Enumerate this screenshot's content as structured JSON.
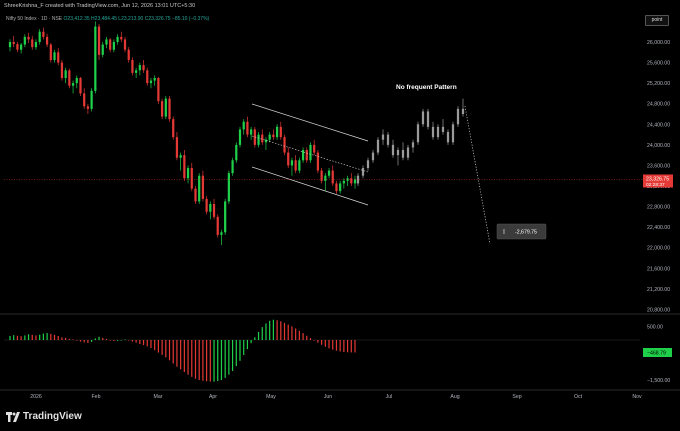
{
  "header": {
    "attribution": "ShreeKrishna_F created with TradingView.com, Jun 12, 2026 13:01 UTC+5:30",
    "symbol": "Nifty 50 Index · 1D · NSE",
    "ohlc": "O23,412.35 H23,484.45 L23,213.90 C23,326.75 −85.10 (−0.37%)"
  },
  "controls": {
    "point_label": "point"
  },
  "brand": {
    "name": "TradingView"
  },
  "chart_data": {
    "type": "candlestick",
    "symbol": "Nifty 50 Index",
    "interval": "1D",
    "exchange": "NSE",
    "ohlc_last": {
      "open": 23412.35,
      "high": 23484.45,
      "low": 23213.9,
      "close": 23326.75,
      "change": -85.1,
      "change_pct": -0.37
    },
    "price_axis": {
      "ticks": [
        26000,
        25600,
        25200,
        24800,
        24400,
        24000,
        23600,
        23200,
        22800,
        22400,
        22000,
        21600,
        21200,
        20800
      ],
      "tick_labels": [
        "26,000.00",
        "25,600.00",
        "25,200.00",
        "24,800.00",
        "24,400.00",
        "24,000.00",
        "23,600.00",
        "23,200.00",
        "22,800.00",
        "22,400.00",
        "22,000.00",
        "21,600.00",
        "21,200.00",
        "20,800.00"
      ],
      "range": [
        20750,
        26350
      ]
    },
    "last_price_label": "23,326.75",
    "countdown_label": "02:28:37",
    "time_axis": {
      "labels": [
        "2026",
        "Feb",
        "Mar",
        "Apr",
        "May",
        "Jun",
        "Jul",
        "Aug",
        "Sep",
        "Oct",
        "Nov"
      ]
    },
    "annotation": "No frequent Pattern",
    "projection_label": "-2,679.75",
    "candles": [
      [
        25900,
        26050,
        25820,
        26000
      ],
      [
        26000,
        26120,
        25900,
        25960
      ],
      [
        25960,
        26000,
        25800,
        25850
      ],
      [
        25850,
        25980,
        25780,
        25950
      ],
      [
        25950,
        26150,
        25900,
        26100
      ],
      [
        26100,
        26180,
        25980,
        26050
      ],
      [
        26050,
        26120,
        25850,
        25900
      ],
      [
        25900,
        26050,
        25850,
        26000
      ],
      [
        26000,
        26250,
        25950,
        26200
      ],
      [
        26200,
        26280,
        26050,
        26100
      ],
      [
        26100,
        26160,
        25900,
        25950
      ],
      [
        25950,
        25980,
        25600,
        25650
      ],
      [
        25650,
        25850,
        25600,
        25800
      ],
      [
        25800,
        25880,
        25550,
        25600
      ],
      [
        25600,
        25650,
        25250,
        25300
      ],
      [
        25300,
        25500,
        25200,
        25450
      ],
      [
        25450,
        25480,
        25100,
        25150
      ],
      [
        25150,
        25250,
        25000,
        25200
      ],
      [
        25200,
        25350,
        25100,
        25300
      ],
      [
        25300,
        25320,
        24950,
        25000
      ],
      [
        25000,
        25100,
        24700,
        24750
      ],
      [
        24750,
        24800,
        24600,
        24700
      ],
      [
        24700,
        25100,
        24650,
        25050
      ],
      [
        25050,
        26400,
        25000,
        26300
      ],
      [
        26300,
        26350,
        25650,
        25750
      ],
      [
        25750,
        26000,
        25700,
        25950
      ],
      [
        25950,
        26100,
        25880,
        26050
      ],
      [
        26050,
        26080,
        25800,
        25850
      ],
      [
        25850,
        26050,
        25800,
        26000
      ],
      [
        26000,
        26150,
        25950,
        26100
      ],
      [
        26100,
        26200,
        26000,
        26050
      ],
      [
        26050,
        26100,
        25800,
        25850
      ],
      [
        25850,
        25900,
        25600,
        25650
      ],
      [
        25650,
        25700,
        25350,
        25400
      ],
      [
        25400,
        25500,
        25300,
        25450
      ],
      [
        25450,
        25600,
        25350,
        25550
      ],
      [
        25550,
        25650,
        25400,
        25450
      ],
      [
        25450,
        25500,
        25150,
        25200
      ],
      [
        25200,
        25300,
        25100,
        25250
      ],
      [
        25250,
        25350,
        25150,
        25300
      ],
      [
        25300,
        25320,
        24800,
        24850
      ],
      [
        24850,
        24900,
        24500,
        24550
      ],
      [
        24550,
        24950,
        24500,
        24900
      ],
      [
        24900,
        24950,
        24450,
        24500
      ],
      [
        24500,
        24550,
        24100,
        24150
      ],
      [
        24150,
        24250,
        23700,
        23750
      ],
      [
        23750,
        23850,
        23500,
        23800
      ],
      [
        23800,
        23900,
        23300,
        23350
      ],
      [
        23350,
        23600,
        23250,
        23550
      ],
      [
        23550,
        23650,
        23100,
        23150
      ],
      [
        23150,
        23200,
        22850,
        22900
      ],
      [
        22900,
        23450,
        22850,
        23400
      ],
      [
        23400,
        23500,
        22900,
        22950
      ],
      [
        22950,
        23000,
        22650,
        22700
      ],
      [
        22700,
        22900,
        22550,
        22850
      ],
      [
        22850,
        22950,
        22550,
        22600
      ],
      [
        22600,
        22650,
        22200,
        22250
      ],
      [
        22250,
        22350,
        22050,
        22300
      ],
      [
        22300,
        22950,
        22250,
        22900
      ],
      [
        22900,
        23500,
        22850,
        23450
      ],
      [
        23450,
        23750,
        23400,
        23700
      ],
      [
        23700,
        24050,
        23650,
        24000
      ],
      [
        24000,
        24350,
        23950,
        24300
      ],
      [
        24300,
        24500,
        24200,
        24450
      ],
      [
        24450,
        24550,
        24150,
        24200
      ],
      [
        24200,
        24350,
        24100,
        24300
      ],
      [
        24300,
        24350,
        23950,
        24000
      ],
      [
        24000,
        24250,
        23950,
        24200
      ],
      [
        24200,
        24300,
        24000,
        24050
      ],
      [
        24050,
        24150,
        23900,
        24100
      ],
      [
        24100,
        24250,
        24050,
        24200
      ],
      [
        24200,
        24300,
        24100,
        24150
      ],
      [
        24150,
        24400,
        24100,
        24350
      ],
      [
        24350,
        24450,
        24100,
        24150
      ],
      [
        24150,
        24200,
        23800,
        23850
      ],
      [
        23850,
        23950,
        23550,
        23600
      ],
      [
        23600,
        23750,
        23400,
        23700
      ],
      [
        23700,
        23800,
        23450,
        23500
      ],
      [
        23500,
        23750,
        23450,
        23700
      ],
      [
        23700,
        23950,
        23650,
        23900
      ],
      [
        23900,
        23950,
        23650,
        23700
      ],
      [
        23700,
        24050,
        23650,
        24000
      ],
      [
        24000,
        24100,
        23800,
        23850
      ],
      [
        23850,
        23900,
        23450,
        23500
      ],
      [
        23500,
        23550,
        23250,
        23300
      ],
      [
        23300,
        23450,
        23100,
        23400
      ],
      [
        23400,
        23550,
        23350,
        23500
      ],
      [
        23500,
        23600,
        23200,
        23250
      ],
      [
        23250,
        23300,
        23050,
        23100
      ],
      [
        23100,
        23300,
        23050,
        23250
      ],
      [
        23250,
        23350,
        23150,
        23300
      ],
      [
        23300,
        23400,
        23200,
        23350
      ],
      [
        23350,
        23450,
        23200,
        23250
      ],
      [
        23250,
        23400,
        23150,
        23327
      ]
    ],
    "projected_candles": [
      [
        23250,
        23450,
        23200,
        23400
      ],
      [
        23400,
        23600,
        23350,
        23550
      ],
      [
        23550,
        23750,
        23500,
        23700
      ],
      [
        23700,
        23900,
        23650,
        23850
      ],
      [
        23850,
        24150,
        23800,
        24100
      ],
      [
        24100,
        24300,
        24000,
        24200
      ],
      [
        24200,
        24250,
        23950,
        24000
      ],
      [
        24000,
        24100,
        23750,
        23800
      ],
      [
        23800,
        23950,
        23600,
        23900
      ],
      [
        23900,
        24050,
        23700,
        23750
      ],
      [
        23750,
        24000,
        23700,
        23950
      ],
      [
        23950,
        24100,
        23850,
        24050
      ],
      [
        24050,
        24450,
        24000,
        24400
      ],
      [
        24400,
        24700,
        24350,
        24650
      ],
      [
        24650,
        24700,
        24300,
        24350
      ],
      [
        24350,
        24450,
        24100,
        24150
      ],
      [
        24150,
        24400,
        24100,
        24350
      ],
      [
        24350,
        24500,
        24200,
        24250
      ],
      [
        24250,
        24300,
        24000,
        24050
      ],
      [
        24050,
        24450,
        24000,
        24400
      ],
      [
        24400,
        24750,
        24350,
        24700
      ],
      [
        24700,
        24900,
        24550,
        24600
      ]
    ],
    "oscillator": {
      "axis_ticks": [
        500,
        -500,
        -1500
      ],
      "axis_labels": [
        "500.00",
        "",
        "−1,500.00"
      ],
      "last_value_label": "−468.79",
      "range": [
        -1800,
        900
      ],
      "values": [
        150,
        180,
        160,
        140,
        170,
        210,
        190,
        170,
        200,
        240,
        260,
        230,
        190,
        150,
        100,
        80,
        40,
        20,
        -20,
        -60,
        -90,
        -110,
        -70,
        60,
        120,
        80,
        40,
        0,
        -40,
        -30,
        -10,
        20,
        -20,
        -60,
        -100,
        -150,
        -190,
        -240,
        -300,
        -380,
        -470,
        -560,
        -650,
        -760,
        -880,
        -1000,
        -1100,
        -1200,
        -1300,
        -1380,
        -1450,
        -1500,
        -1530,
        -1550,
        -1560,
        -1560,
        -1540,
        -1500,
        -1420,
        -1300,
        -1160,
        -980,
        -780,
        -560,
        -340,
        -120,
        100,
        300,
        480,
        620,
        720,
        760,
        740,
        700,
        640,
        580,
        510,
        430,
        350,
        260,
        160,
        70,
        -20,
        -100,
        -180,
        -250,
        -310,
        -360,
        -400,
        -430,
        -450,
        -460,
        -465,
        -468.79
      ]
    }
  }
}
